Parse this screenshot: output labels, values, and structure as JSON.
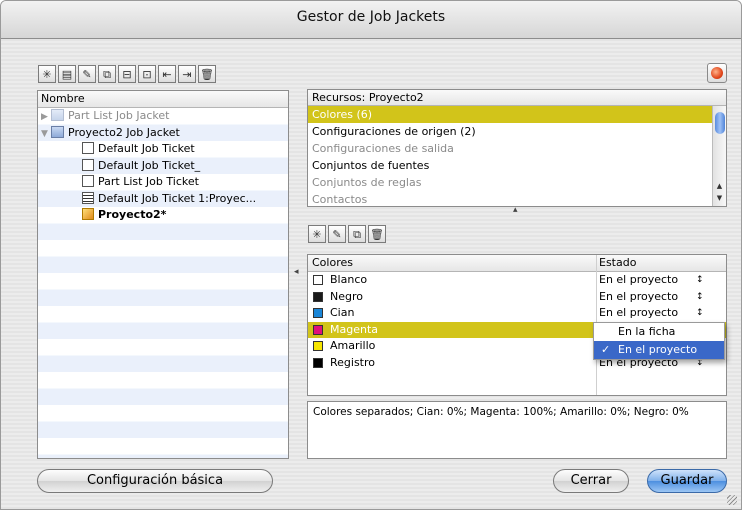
{
  "window": {
    "title": "Gestor de Job Jackets"
  },
  "toolbar_left": {
    "icons": [
      "new-jacket-icon",
      "new-ticket-icon",
      "edit-icon",
      "duplicate-icon",
      "open-folder-icon",
      "open-folder-alt-icon",
      "import-icon",
      "export-icon",
      "delete-icon"
    ]
  },
  "toolbar_mid": {
    "icons": [
      "new-icon",
      "edit-icon",
      "duplicate-icon",
      "delete-icon"
    ]
  },
  "tree": {
    "header": "Nombre",
    "items": [
      {
        "label": "Part List Job Jacket"
      },
      {
        "label": "Proyecto2 Job Jacket"
      },
      {
        "label": "Default Job Ticket"
      },
      {
        "label": "Default Job Ticket_"
      },
      {
        "label": "Part List Job Ticket"
      },
      {
        "label": "Default Job Ticket 1:Proyec..."
      },
      {
        "label": "Proyecto2*"
      }
    ]
  },
  "resources": {
    "header": "Recursos: Proyecto2",
    "items": [
      {
        "label": "Colores (6)"
      },
      {
        "label": "Configuraciones de origen (2)"
      },
      {
        "label": "Configuraciones de salida"
      },
      {
        "label": "Conjuntos de fuentes"
      },
      {
        "label": "Conjuntos de reglas"
      },
      {
        "label": "Contactos"
      }
    ]
  },
  "colors_table": {
    "col_name": "Colores",
    "col_state": "Estado",
    "rows": [
      {
        "name": "Blanco",
        "state": "En el proyecto",
        "swatch": "#ffffff"
      },
      {
        "name": "Negro",
        "state": "En el proyecto",
        "swatch": "#1a1a1a"
      },
      {
        "name": "Cian",
        "state": "En el proyecto",
        "swatch": "#1a86d8"
      },
      {
        "name": "Magenta",
        "state": "",
        "swatch": "#e0107a"
      },
      {
        "name": "Amarillo",
        "state": "",
        "swatch": "#f7e600"
      },
      {
        "name": "Registro",
        "state": "En el proyecto",
        "swatch": "#000000"
      }
    ],
    "updown": "↕"
  },
  "popup": {
    "options": [
      "En la ficha",
      "En el proyecto"
    ],
    "checkmark": "✓"
  },
  "info": {
    "text": "Colores separados; Cian: 0%; Magenta: 100%; Amarillo: 0%; Negro: 0%"
  },
  "buttons": {
    "basic": "Configuración básica",
    "close": "Cerrar",
    "save": "Guardar"
  },
  "colors": {
    "selection": "#d2c41a",
    "menu_highlight": "#3a68c8",
    "default_button": "#4d8fe0"
  }
}
